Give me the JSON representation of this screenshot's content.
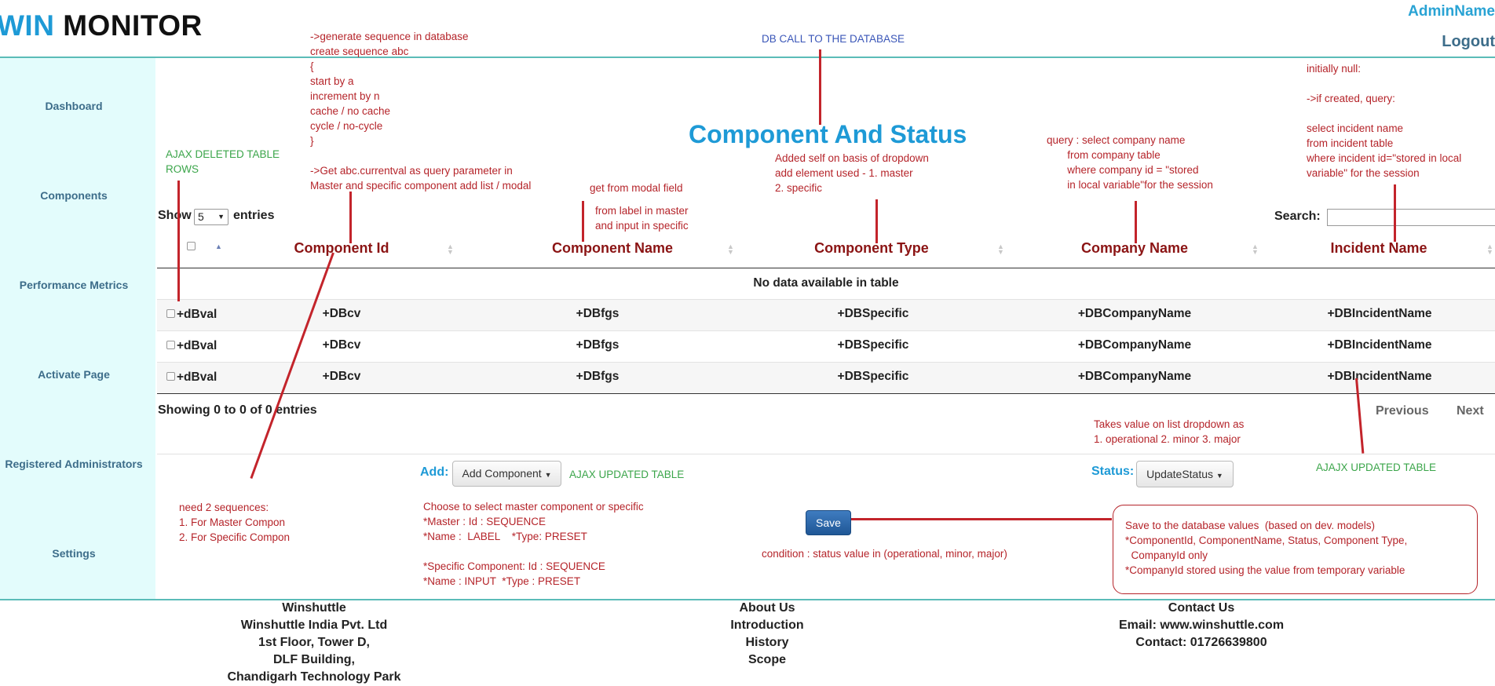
{
  "header": {
    "logo_part1": "WIN",
    "logo_part2": "MONITOR",
    "admin_name": "AdminName",
    "logout": "Logout"
  },
  "sidebar": {
    "items": [
      "Dashboard",
      "Components",
      "Performance Metrics",
      "Activate Page",
      "Registered Administrators",
      "Settings"
    ]
  },
  "main": {
    "title": "Component And Status",
    "show_label": "Show",
    "entries_value": "5",
    "entries_label": "entries",
    "search_label": "Search:",
    "columns": [
      "Component Id",
      "Component Name",
      "Component Type",
      "Company Name",
      "Incident Name"
    ],
    "empty_message": "No data available in table",
    "rows": [
      {
        "val": "+dBval",
        "id": "+DBcv",
        "name": "+DBfgs",
        "type": "+DBSpecific",
        "company": "+DBCompanyName",
        "incident": "+DBIncidentName"
      },
      {
        "val": "+dBval",
        "id": "+DBcv",
        "name": "+DBfgs",
        "type": "+DBSpecific",
        "company": "+DBCompanyName",
        "incident": "+DBIncidentName"
      },
      {
        "val": "+dBval",
        "id": "+DBcv",
        "name": "+DBfgs",
        "type": "+DBSpecific",
        "company": "+DBCompanyName",
        "incident": "+DBIncidentName"
      }
    ],
    "info": "Showing 0 to 0 of 0 entries",
    "previous": "Previous",
    "next": "Next",
    "add_label": "Add:",
    "add_button": "Add Component",
    "status_label": "Status:",
    "status_button": "UpdateStatus",
    "save_button": "Save"
  },
  "annotations": {
    "sequence": "->generate sequence in database\ncreate sequence abc\n{\nstart by a\nincrement by n\ncache / no cache\ncycle / no-cycle\n}\n\n->Get abc.currentval as query parameter in\nMaster and specific component add list / modal",
    "db_call": "DB CALL TO THE DATABASE",
    "ajax_deleted": "AJAX DELETED TABLE\nROWS",
    "get_modal": "get from modal field",
    "from_label": "from label in master\nand input in specific",
    "added_self": "Added self on basis of dropdown\nadd element used - 1. master\n2. specific",
    "query_company": "query : select company name\n       from company table\n       where company id = \"stored\n       in local variable\"for the session",
    "incident": "initially null:\n\n->if created, query:\n\nselect incident name\nfrom incident table\nwhere incident id=\"stored in local\nvariable\" for the session",
    "takes_value": "Takes value on list dropdown as\n1. operational 2. minor 3. major",
    "ajax_updated_1": "AJAX UPDATED TABLE",
    "ajax_updated_2": "AJAJX UPDATED TABLE",
    "need_sequences": "need 2 sequences:\n1. For Master Compon\n2. For Specific Compon",
    "choose": "Choose to select master component or specific\n*Master : Id : SEQUENCE\n*Name :  LABEL    *Type: PRESET\n\n*Specific Component: Id : SEQUENCE\n*Name : INPUT  *Type : PRESET",
    "condition": "condition : status value in (operational, minor, major)",
    "save_db": "Save to the database values  (based on dev. models)\n*ComponentId, ComponentName, Status, Component Type,\n  CompanyId only\n*CompanyId stored using the value from temporary variable"
  },
  "footer": {
    "col1": [
      "Winshuttle",
      "Winshuttle India Pvt. Ltd",
      "1st Floor, Tower D,",
      "DLF Building,",
      "Chandigarh Technology Park"
    ],
    "col2": [
      "About Us",
      "Introduction",
      "History",
      "Scope"
    ],
    "col3": [
      "Contact Us",
      "Email: www.winshuttle.com",
      "Contact: 01726639800"
    ]
  },
  "colors": {
    "accent": "#1e9ad6",
    "header_text": "#8b1414",
    "annotation_red": "#b5242a",
    "annotation_green": "#3ba54a",
    "sidebar_bg": "#e3fcfc"
  }
}
